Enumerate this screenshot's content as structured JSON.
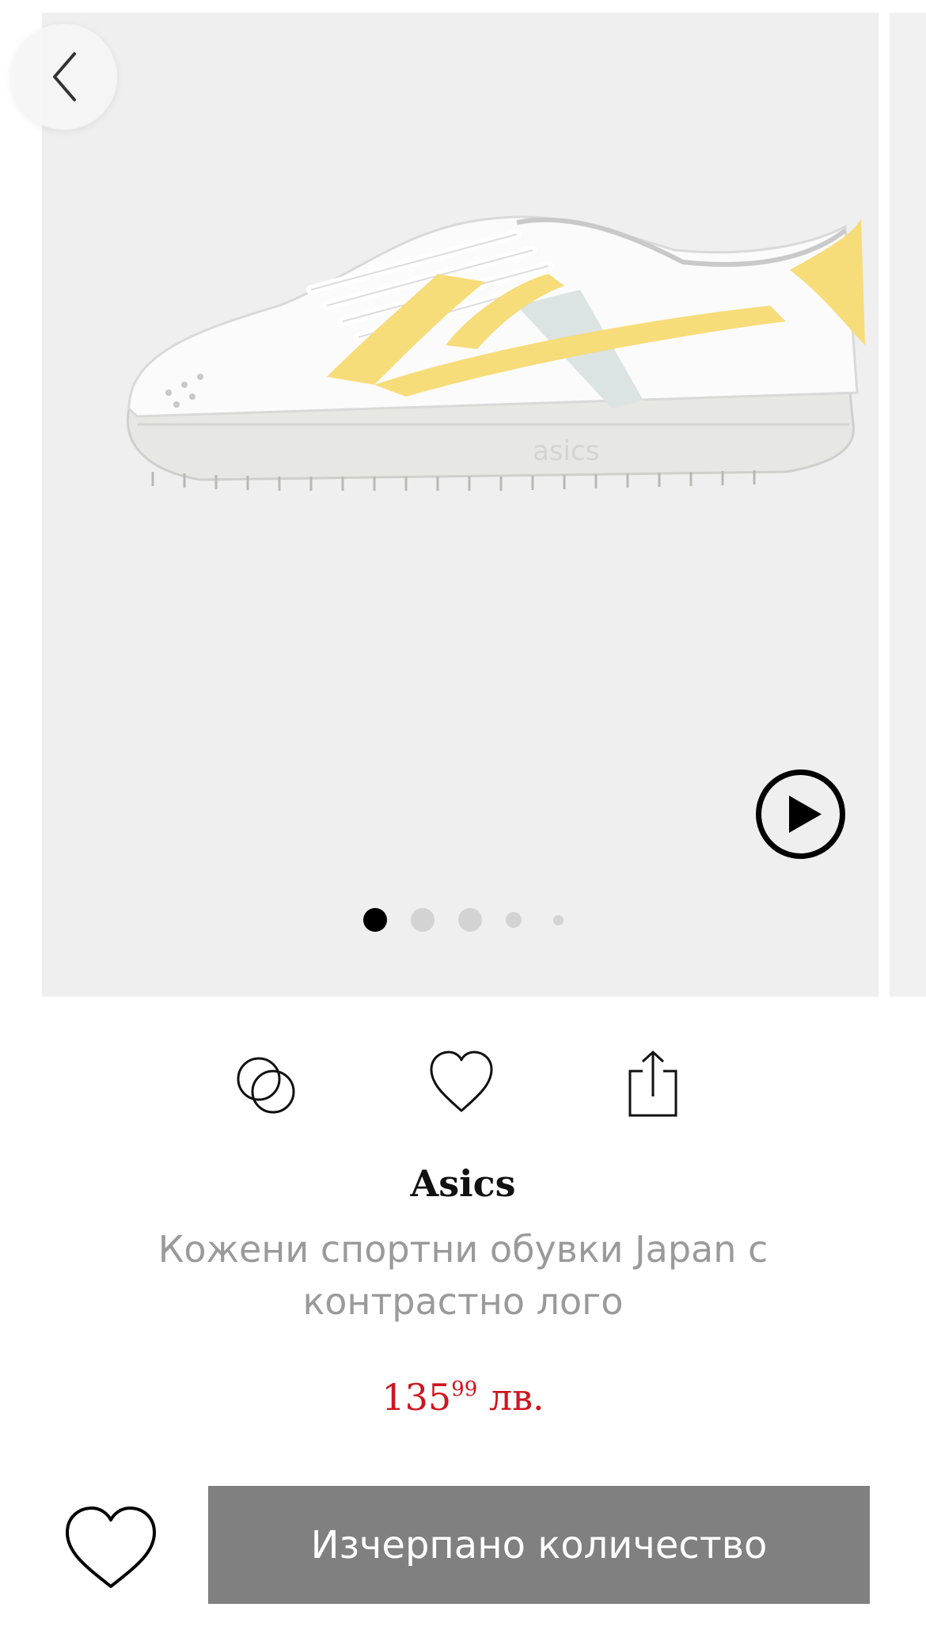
{
  "product": {
    "brand": "Asics",
    "title": "Кожени спортни обувки Japan с контрастно лого",
    "price": {
      "main": "135",
      "decimals": "99",
      "currency": "лв."
    }
  },
  "gallery": {
    "dots_count": 5,
    "active_index": 0
  },
  "cta": {
    "label": "Изчерпано количество"
  },
  "colors": {
    "price": "#d0141d",
    "cta_bg": "#808080",
    "accent_shoe": "#f7dc7a"
  },
  "icons": {
    "back": "chevron-left-icon",
    "play": "play-icon",
    "compare": "compare-icon",
    "favorite": "heart-icon",
    "share": "share-icon"
  }
}
